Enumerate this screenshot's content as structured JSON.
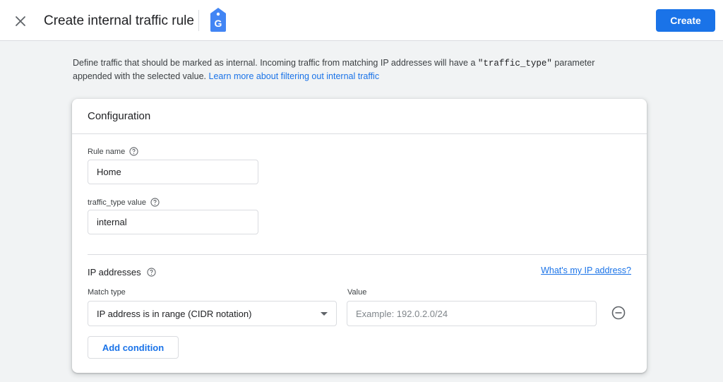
{
  "header": {
    "title": "Create internal traffic rule",
    "create_label": "Create",
    "logo_letter": "G"
  },
  "intro": {
    "text_before": "Define traffic that should be marked as internal. Incoming traffic from matching IP addresses will have a ",
    "code": "\"traffic_type\"",
    "text_after": " parameter appended with the selected value. ",
    "link": "Learn more about filtering out internal traffic"
  },
  "config": {
    "title": "Configuration",
    "rule_name": {
      "label": "Rule name",
      "value": "Home"
    },
    "traffic_type": {
      "label": "traffic_type value",
      "value": "internal"
    }
  },
  "ip": {
    "title": "IP addresses",
    "link": "What's my IP address?",
    "match_type_label": "Match type",
    "match_type_value": "IP address is in range (CIDR notation)",
    "value_label": "Value",
    "value_placeholder": "Example: 192.0.2.0/24",
    "value": "",
    "add_condition": "Add condition"
  },
  "colors": {
    "accent": "#1a73e8",
    "background": "#f1f3f4",
    "border": "#dadce0"
  },
  "icons": [
    "close-icon",
    "tag-manager-logo-icon",
    "help-icon",
    "chevron-down-icon",
    "remove-circle-icon"
  ]
}
